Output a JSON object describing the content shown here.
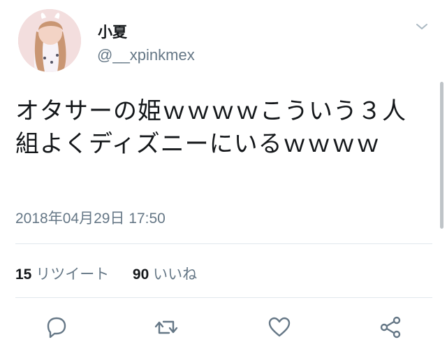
{
  "tweet": {
    "display_name": "小夏",
    "handle": "@__xpinkmex",
    "text": "オタサーの姫ｗｗｗｗこういう３人組よくディズニーにいるｗｗｗｗ",
    "timestamp": "2018年04月29日 17:50"
  },
  "stats": {
    "retweets_count": "15",
    "retweets_label": "リツイート",
    "likes_count": "90",
    "likes_label": "いいね"
  },
  "icons": {
    "reply": "reply-icon",
    "retweet": "retweet-icon",
    "like": "heart-icon",
    "share": "share-icon",
    "menu": "chevron-down-icon"
  },
  "colors": {
    "text": "#14171a",
    "secondary": "#657786",
    "divider": "#e1e8ed"
  }
}
